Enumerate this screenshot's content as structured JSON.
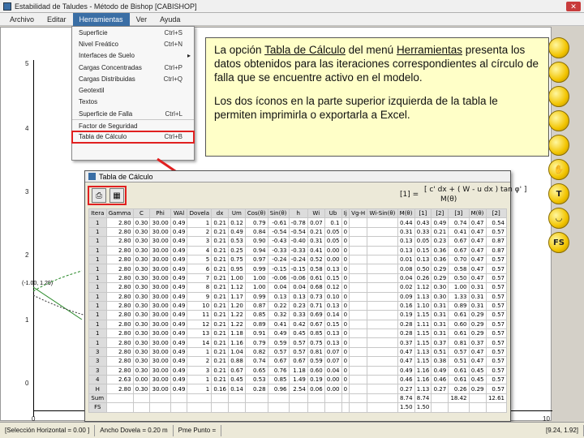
{
  "window": {
    "title": "Estabilidad de Taludes - Método de Bishop [CABISHOP]",
    "close": "✕"
  },
  "menubar": {
    "items": [
      "Archivo",
      "Editar",
      "Herramientas",
      "Ver",
      "Ayuda"
    ]
  },
  "dropdown": {
    "items": [
      {
        "label": "Superficie",
        "shortcut": "Ctrl+S"
      },
      {
        "label": "Nivel Freático",
        "shortcut": "Ctrl+N"
      },
      {
        "label": "Interfaces de Suelo",
        "shortcut": ""
      },
      {
        "label": "Cargas Concentradas",
        "shortcut": "Ctrl+P"
      },
      {
        "label": "Cargas Distribuidas",
        "shortcut": "Ctrl+Q"
      },
      {
        "label": "Geotextil",
        "shortcut": ""
      },
      {
        "label": "Textos",
        "shortcut": ""
      },
      {
        "label": "Superficie de Falla",
        "shortcut": "Ctrl+L"
      },
      {
        "label": "Factor de Seguridad",
        "shortcut": ""
      },
      {
        "label": "Tabla de Cálculo",
        "shortcut": "Ctrl+B"
      }
    ]
  },
  "callout": {
    "p1_a": "La opción ",
    "p1_b": "Tabla de Cálculo",
    "p1_c": " del menú ",
    "p1_d": "Herramientas",
    "p1_e": " presenta los datos obtenidos para las iteraciones correspondientes al círculo de falla que se encuentre activo en el modelo.",
    "p2": "Los dos íconos en la parte superior izquierda de la tabla le permiten imprimirla o exportarla a Excel."
  },
  "plot": {
    "yticks": [
      "5",
      "4",
      "3",
      "2",
      "1",
      "0"
    ],
    "xticks": [
      "0",
      "10"
    ],
    "coord_label": "(-1.00, 1.29)"
  },
  "right_toolbar": [
    "T",
    "FS"
  ],
  "table_window": {
    "title": "Tabla de Cálculo",
    "formula_lhs": "[1] =",
    "formula_num": "[ c' dx + ( W - u dx ) tan φ' ]",
    "formula_den": "M(θ)",
    "headers": [
      "Itera",
      "Gamma",
      "C",
      "Phi",
      "WAl",
      "Dovela",
      "dx",
      "Um",
      "Cos(θ)",
      "Sin(θ)",
      "h",
      "Wi",
      "Ub",
      "Ij",
      "Vg-H",
      "Wi-Sin(θ)",
      "M(θ)",
      "[1]",
      "[2]",
      "[3]",
      "M(θ)",
      "[2]",
      "[3]"
    ],
    "rows": [
      [
        "1",
        "2.80",
        "0.30",
        "30.00",
        "0.49",
        "1",
        "0.21",
        "0.12",
        "0.79",
        "-0.61",
        "-0.78",
        "0.07",
        "0.1",
        "0",
        "",
        "",
        "0.44",
        "0.43",
        "0.49",
        "0.74",
        "0.47",
        "0.54"
      ],
      [
        "1",
        "2.80",
        "0.30",
        "30.00",
        "0.49",
        "2",
        "0.21",
        "0.49",
        "0.84",
        "-0.54",
        "-0.54",
        "0.21",
        "0.05",
        "0",
        "",
        "",
        "0.31",
        "0.33",
        "0.21",
        "0.41",
        "0.47",
        "0.57"
      ],
      [
        "1",
        "2.80",
        "0.30",
        "30.00",
        "0.49",
        "3",
        "0.21",
        "0.53",
        "0.90",
        "-0.43",
        "-0.40",
        "0.31",
        "0.05",
        "0",
        "",
        "",
        "0.13",
        "0.05",
        "0.23",
        "0.67",
        "0.47",
        "0.87"
      ],
      [
        "1",
        "2.80",
        "0.30",
        "30.00",
        "0.49",
        "4",
        "0.21",
        "0.25",
        "0.94",
        "-0.33",
        "-0.33",
        "0.41",
        "0.00",
        "0",
        "",
        "",
        "0.13",
        "0.15",
        "0.36",
        "0.67",
        "0.47",
        "0.87"
      ],
      [
        "1",
        "2.80",
        "0.30",
        "30.00",
        "0.49",
        "5",
        "0.21",
        "0.75",
        "0.97",
        "-0.24",
        "-0.24",
        "0.52",
        "0.00",
        "0",
        "",
        "",
        "0.01",
        "0.13",
        "0.36",
        "0.70",
        "0.47",
        "0.57"
      ],
      [
        "1",
        "2.80",
        "0.30",
        "30.00",
        "0.49",
        "6",
        "0.21",
        "0.95",
        "0.99",
        "-0.15",
        "-0.15",
        "0.58",
        "0.13",
        "0",
        "",
        "",
        "0.08",
        "0.50",
        "0.29",
        "0.58",
        "0.47",
        "0.57"
      ],
      [
        "1",
        "2.80",
        "0.30",
        "30.00",
        "0.49",
        "7",
        "0.21",
        "1.00",
        "1.00",
        "-0.06",
        "-0.06",
        "0.61",
        "0.15",
        "0",
        "",
        "",
        "0.04",
        "0.26",
        "0.29",
        "0.50",
        "0.47",
        "0.57"
      ],
      [
        "1",
        "2.80",
        "0.30",
        "30.00",
        "0.49",
        "8",
        "0.21",
        "1.12",
        "1.00",
        "0.04",
        "0.04",
        "0.68",
        "0.12",
        "0",
        "",
        "",
        "0.02",
        "1.12",
        "0.30",
        "1.00",
        "0.31",
        "0.57"
      ],
      [
        "1",
        "2.80",
        "0.30",
        "30.00",
        "0.49",
        "9",
        "0.21",
        "1.17",
        "0.99",
        "0.13",
        "0.13",
        "0.73",
        "0.10",
        "0",
        "",
        "",
        "0.09",
        "1.13",
        "0.30",
        "1.33",
        "0.31",
        "0.57"
      ],
      [
        "1",
        "2.80",
        "0.30",
        "30.00",
        "0.49",
        "10",
        "0.21",
        "1.20",
        "0.87",
        "0.22",
        "0.23",
        "0.71",
        "0.13",
        "0",
        "",
        "",
        "0.16",
        "1.10",
        "0.31",
        "0.89",
        "0.31",
        "0.57"
      ],
      [
        "1",
        "2.80",
        "0.30",
        "30.00",
        "0.49",
        "11",
        "0.21",
        "1.22",
        "0.85",
        "0.32",
        "0.33",
        "0.69",
        "0.14",
        "0",
        "",
        "",
        "0.19",
        "1.15",
        "0.31",
        "0.61",
        "0.29",
        "0.57"
      ],
      [
        "1",
        "2.80",
        "0.30",
        "30.00",
        "0.49",
        "12",
        "0.21",
        "1.22",
        "0.89",
        "0.41",
        "0.42",
        "0.67",
        "0.15",
        "0",
        "",
        "",
        "0.28",
        "1.11",
        "0.31",
        "0.60",
        "0.29",
        "0.57"
      ],
      [
        "1",
        "2.80",
        "0.30",
        "30.00",
        "0.49",
        "13",
        "0.21",
        "1.18",
        "0.91",
        "0.49",
        "0.45",
        "0.85",
        "0.13",
        "0",
        "",
        "",
        "0.28",
        "1.15",
        "0.31",
        "0.61",
        "0.29",
        "0.57"
      ],
      [
        "1",
        "2.80",
        "0.30",
        "30.00",
        "0.49",
        "14",
        "0.21",
        "1.16",
        "0.79",
        "0.59",
        "0.57",
        "0.75",
        "0.13",
        "0",
        "",
        "",
        "0.37",
        "1.15",
        "0.37",
        "0.81",
        "0.37",
        "0.57"
      ],
      [
        "3",
        "2.80",
        "0.30",
        "30.00",
        "0.49",
        "1",
        "0.21",
        "1.04",
        "0.82",
        "0.57",
        "0.57",
        "0.81",
        "0.07",
        "0",
        "",
        "",
        "0.47",
        "1.13",
        "0.51",
        "0.57",
        "0.47",
        "0.57"
      ],
      [
        "3",
        "2.80",
        "0.30",
        "30.00",
        "0.49",
        "2",
        "0.21",
        "0.88",
        "0.74",
        "0.67",
        "0.67",
        "0.59",
        "0.07",
        "0",
        "",
        "",
        "0.47",
        "1.15",
        "0.38",
        "0.51",
        "0.47",
        "0.57"
      ],
      [
        "3",
        "2.80",
        "0.30",
        "30.00",
        "0.49",
        "3",
        "0.21",
        "0.67",
        "0.65",
        "0.76",
        "1.18",
        "0.60",
        "0.04",
        "0",
        "",
        "",
        "0.49",
        "1.16",
        "0.49",
        "0.61",
        "0.45",
        "0.57"
      ],
      [
        "4",
        "2.63",
        "0.00",
        "30.00",
        "0.49",
        "1",
        "0.21",
        "0.45",
        "0.53",
        "0.85",
        "1.49",
        "0.19",
        "0.00",
        "0",
        "",
        "",
        "0.46",
        "1.16",
        "0.46",
        "0.61",
        "0.45",
        "0.57"
      ],
      [
        "H",
        "2.80",
        "0.30",
        "30.00",
        "0.49",
        "1",
        "0.16",
        "0.14",
        "0.28",
        "0.96",
        "2.54",
        "0.06",
        "0.00",
        "0",
        "",
        "",
        "0.27",
        "1.13",
        "0.27",
        "0.26",
        "0.29",
        "0.57"
      ]
    ],
    "sum_label": "Sum",
    "sum_values": [
      "8.74",
      "8.74",
      "18.42",
      "12.61"
    ],
    "fs_label": "FS",
    "fs_values": [
      "1.50",
      "1.50"
    ]
  },
  "statusbar": {
    "seg1": "[Selección Horizontal = 0.00 ]",
    "seg2": "Ancho Dovela = 0.20 m",
    "seg3": "Pme Punto =",
    "seg4": "[9.24, 1.92]"
  },
  "colors": {
    "highlight": "#e02020",
    "callout_bg": "#ffffc8",
    "menu_active": "#3a6ea5"
  }
}
